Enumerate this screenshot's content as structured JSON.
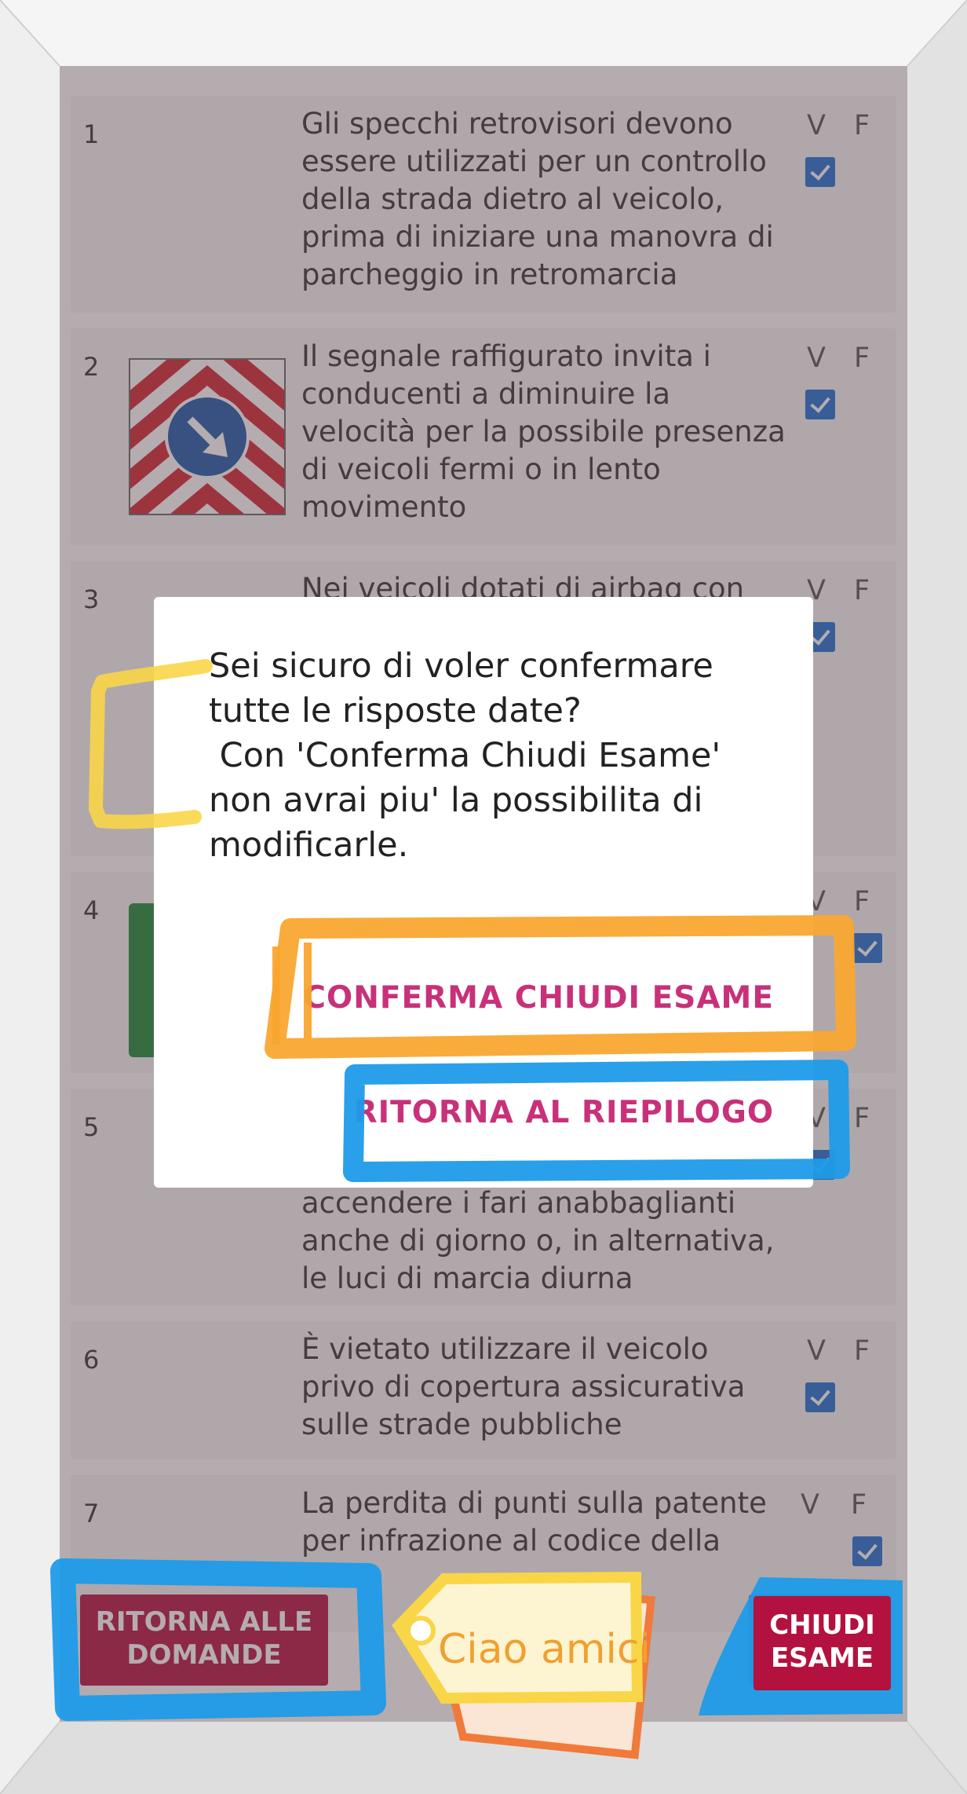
{
  "questions": [
    {
      "num": "1",
      "text": "Gli specchi retrovisori devono essere utilizzati per un controllo della strada dietro al veicolo, prima di iniziare una manovra di parcheggio in retromarcia",
      "v": "V",
      "f": "F",
      "answer": "V"
    },
    {
      "num": "2",
      "text": "Il segnale raffigurato invita i conducenti a diminuire la velocità per la possibile presenza di veicoli fermi o in lento movimento",
      "v": "V",
      "f": "F",
      "answer": "V"
    },
    {
      "num": "3",
      "text": "Nei veicoli dotati di airbag con",
      "v": "V",
      "f": "F",
      "answer": "V"
    },
    {
      "num": "4",
      "text": "",
      "v": "V",
      "f": "F",
      "answer": "F"
    },
    {
      "num": "5",
      "text": "accendere i fari anabbaglianti anche di giorno o, in alternativa, le luci di marcia diurna",
      "v": "V",
      "f": "F",
      "answer": "V"
    },
    {
      "num": "6",
      "text": "È vietato utilizzare il veicolo privo di copertura assicurativa sulle strade pubbliche",
      "v": "V",
      "f": "F",
      "answer": "V"
    },
    {
      "num": "7",
      "text": "La perdita di punti sulla patente per infrazione al codice della",
      "v": "V",
      "f": "F",
      "answer": "F"
    }
  ],
  "dialog": {
    "message": "Sei sicuro di voler confermare tutte le risposte date?\n Con 'Conferma Chiudi Esame' non avrai piu' la possibilita di modificarle.",
    "confirm_label": "CONFERMA CHIUDI ESAME",
    "back_label": "RITORNA AL RIEPILOGO"
  },
  "bottom_bar": {
    "back_label": "RITORNA ALLE\nDOMANDE",
    "close_label": "CHIUDI\nESAME"
  },
  "sticker": {
    "text": "Ciao amici"
  },
  "colors": {
    "checkbox": "#1e6fd1",
    "bottom_button": "#b3123f",
    "dialog_button_text": "#c8317a",
    "highlight_yellow": "#f9d648",
    "highlight_orange": "#f9a630",
    "highlight_blue": "#1d9be8"
  }
}
